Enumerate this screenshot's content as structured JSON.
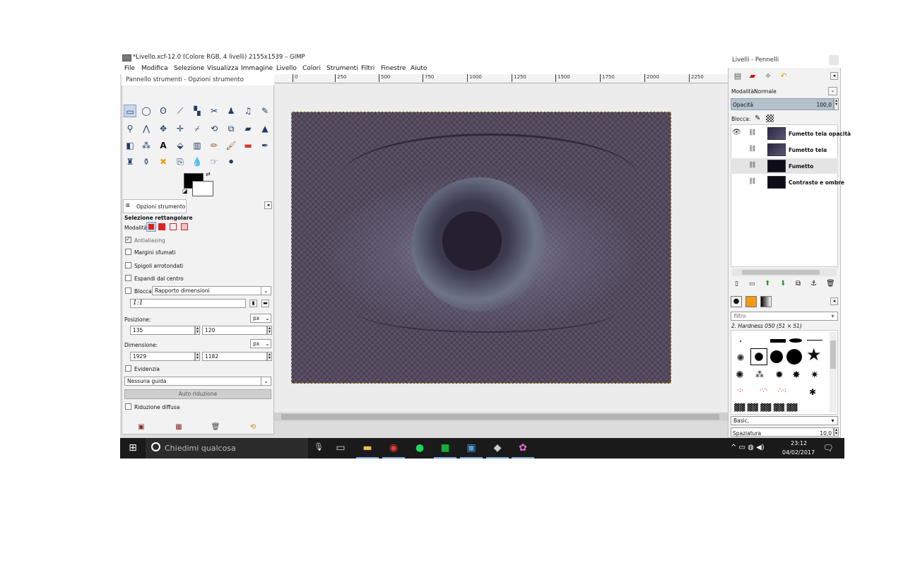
{
  "window": {
    "title": "*Livello.xcf-12.0 (Colore RGB, 4 livelli) 2155x1539 – GIMP"
  },
  "menu": [
    "File",
    "Modifica",
    "Selezione",
    "Visualizza",
    "Immagine",
    "Livello",
    "Colori",
    "Strumenti",
    "Filtri",
    "Finestre",
    "Aiuto"
  ],
  "ruler": [
    "0",
    "250",
    "500",
    "750",
    "1000",
    "1250",
    "1500",
    "1750",
    "2000",
    "2250"
  ],
  "toolbox": {
    "title": "Pannello strumenti - Opzioni strumento",
    "options_tab": "Opzioni strumento",
    "section": "Selezione rettangolare",
    "mode_label": "Modalità:",
    "antialiasing": "Antialiasing",
    "feather": "Margini sfumati",
    "rounded": "Spigoli arrotondati",
    "expand": "Espandi dal centro",
    "fixed_label": "Blocca:",
    "fixed_value": "Rapporto dimensioni",
    "ratio_value": "1:1",
    "position_label": "Posizione:",
    "position_unit": "px",
    "pos_x": "135",
    "pos_y": "120",
    "size_label": "Dimensione:",
    "size_unit": "px",
    "size_w": "1929",
    "size_h": "1182",
    "highlight": "Evidenzia",
    "guides": "Nessuna guida",
    "auto_shrink": "Auto riduzione",
    "shrink_merged": "Riduzione diffusa"
  },
  "layers": {
    "title": "Livelli - Pennelli",
    "mode_label": "Modalità:",
    "mode_value": "Normale",
    "opacity_label": "Opacità",
    "opacity_value": "100,0",
    "lock_label": "Blocca:",
    "items": [
      {
        "name": "Fumetto tela opacità"
      },
      {
        "name": "Fumetto tela"
      },
      {
        "name": "Fumetto"
      },
      {
        "name": "Contrasto e ombre"
      }
    ]
  },
  "brushes": {
    "filter_placeholder": "filtro",
    "brush_name": "2. Hardness 050 (51 × 51)",
    "category": "Basic,",
    "spacing_label": "Spaziatura",
    "spacing_value": "10,0"
  },
  "taskbar": {
    "search_placeholder": "Chiedimi qualcosa",
    "time": "23:12",
    "date": "04/02/2017"
  },
  "colors": {
    "foreground": "#000000",
    "background": "#ffffff",
    "taskbar": "#1a1a1a"
  }
}
